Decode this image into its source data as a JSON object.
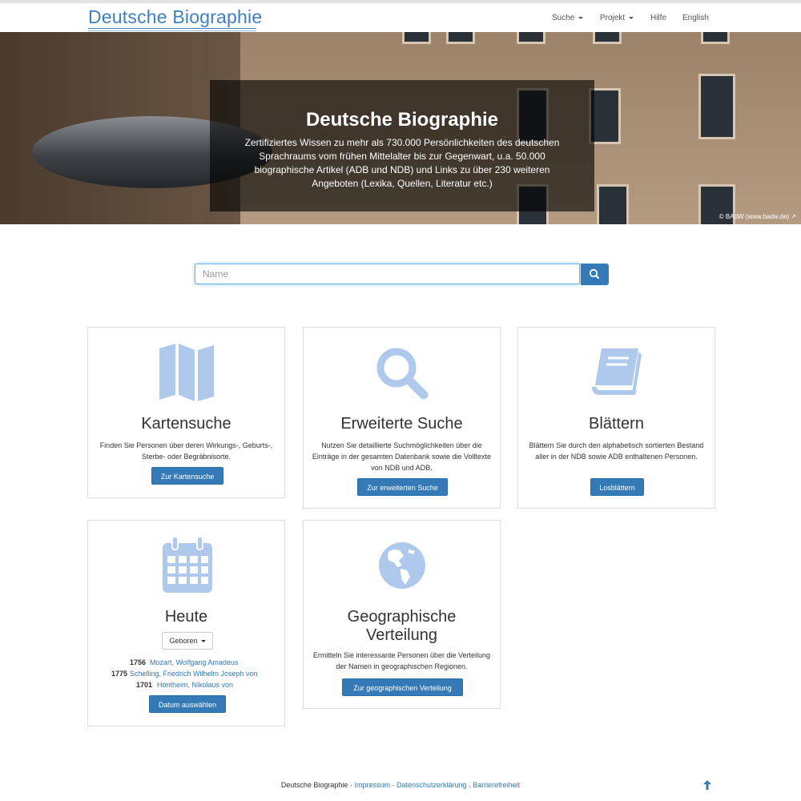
{
  "header": {
    "logo": "Deutsche Biographie",
    "nav": {
      "suche": "Suche",
      "projekt": "Projekt",
      "hilfe": "Hilfe",
      "english": "English"
    }
  },
  "hero": {
    "title": "Deutsche Biographie",
    "text": "Zertifiziertes Wissen zu mehr als 730.000 Persönlichkeiten des deutschen Sprachraums vom frühen Mittelalter bis zur Gegenwart, u.a. 50.000 biographische Artikel (ADB und NDB) und Links zu über 230 weiteren Angeboten (Lexika, Quellen, Literatur etc.)",
    "credit": "© BAdW (www.badw.de)"
  },
  "search": {
    "placeholder": "Name",
    "button_icon": "search-icon"
  },
  "cards": {
    "map": {
      "icon": "map-icon",
      "title": "Kartensuche",
      "desc": "Finden Sie Personen über deren Wirkungs-, Geburts-, Sterbe- oder Begräbnisorte.",
      "button": "Zur Kartensuche"
    },
    "advanced": {
      "icon": "search-icon",
      "title": "Erweiterte Suche",
      "desc": "Nutzen Sie detaillierte Suchmöglichkeiten über die Einträge in der gesamten Datenbank sowie die Volltexte von NDB und ADB.",
      "button": "Zur erweiterten Suche"
    },
    "browse": {
      "icon": "book-icon",
      "title": "Blättern",
      "desc": "Blättern Sie durch den alphabetisch sortierten Bestand aller in der NDB sowie ADB enthaltenen Personen.",
      "button": "Losblättern"
    },
    "today": {
      "icon": "calendar-icon",
      "title": "Heute",
      "dropdown": "Geboren",
      "entries": [
        {
          "year": "1756",
          "name": "Mozart, Wolfgang Amadeus"
        },
        {
          "year": "1775",
          "name": "Schelling, Friedrich Wilhelm Joseph von"
        },
        {
          "year": "1701",
          "name": "Hontheim, Nikolaus von"
        }
      ],
      "button": "Datum auswählen"
    },
    "geo": {
      "icon": "globe-icon",
      "title_line1": "Geographische",
      "title_line2": "Verteilung",
      "desc": "Ermitteln Sie interessante Personen über die Verteilung der Namen in geographischen Regionen.",
      "button": "Zur geographischen Verteilung"
    }
  },
  "footer": {
    "brand": "Deutsche Biographie",
    "sep": "·",
    "impressum": "Impressum",
    "datenschutz": "Datenschutzerklärung",
    "dot": ".",
    "barriere": "Barrierefreiheit",
    "up_icon": "arrow-up-icon"
  },
  "colors": {
    "primary": "#337ab7",
    "icon_fill": "#aec9ec",
    "logo": "#3f7fc0"
  }
}
